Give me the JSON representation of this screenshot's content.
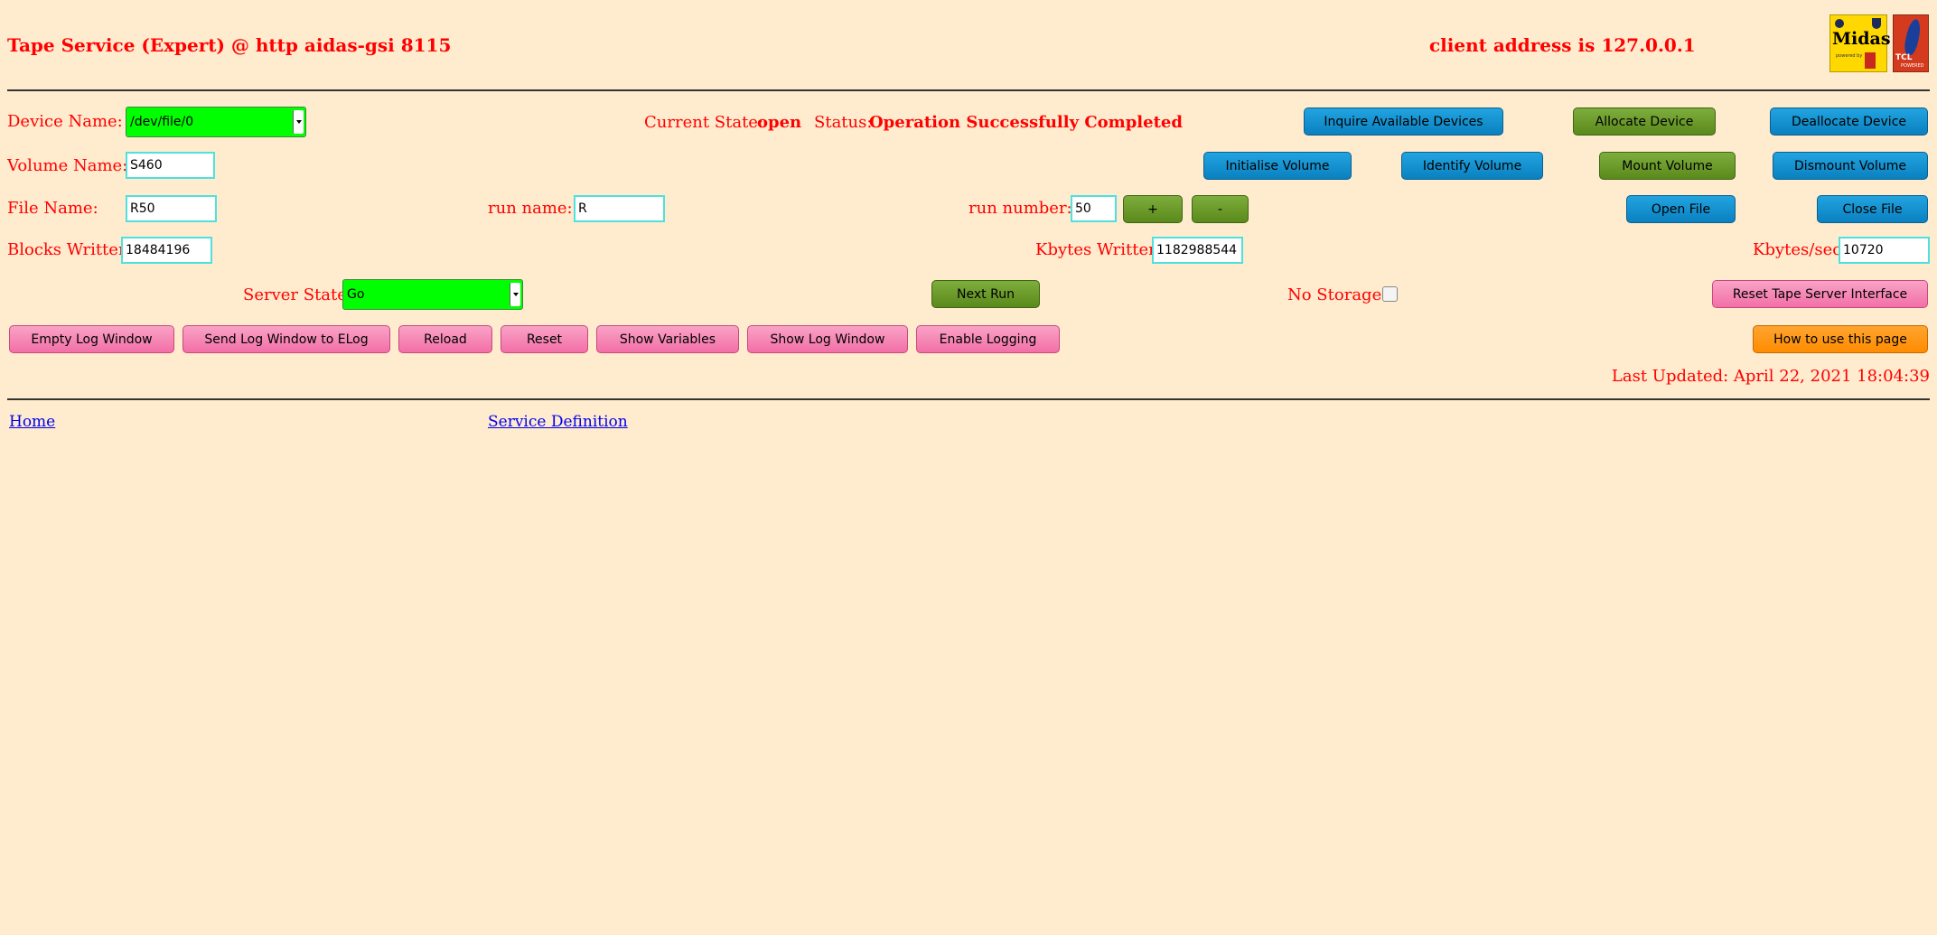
{
  "header": {
    "title": "Tape Service (Expert) @ http aidas-gsi 8115",
    "client_address": "client address is 127.0.0.1",
    "logos": {
      "midas_text": "Midas",
      "midas_small": "powered by",
      "tcl_text": "TCL",
      "tcl_small": "POWERED"
    }
  },
  "device": {
    "label": "Device Name:",
    "selected": "/dev/file/0",
    "current_state_label": "Current State:",
    "current_state": "open",
    "status_label": "Status:",
    "status": "Operation Successfully Completed",
    "inquire_button": "Inquire Available Devices",
    "allocate_button": "Allocate Device",
    "deallocate_button": "Deallocate Device"
  },
  "volume": {
    "label": "Volume Name:",
    "value": "S460",
    "initialise_button": "Initialise Volume",
    "identify_button": "Identify Volume",
    "mount_button": "Mount Volume",
    "dismount_button": "Dismount Volume"
  },
  "file": {
    "label": "File Name:",
    "value": "R50",
    "run_name_label": "run name:",
    "run_name": "R",
    "run_number_label": "run number:",
    "run_number": "50",
    "plus_button": "+",
    "minus_button": "-",
    "open_button": "Open File",
    "close_button": "Close File"
  },
  "stats": {
    "blocks_label": "Blocks Written:",
    "blocks": "18484196",
    "kbytes_label": "Kbytes Written:",
    "kbytes": "1182988544",
    "rate_label": "Kbytes/sec:",
    "rate": "10720"
  },
  "server": {
    "state_label": "Server State",
    "state": "Go",
    "next_run_button": "Next Run",
    "no_storage_label": "No Storage",
    "no_storage_checked": false,
    "reset_interface_button": "Reset Tape Server Interface"
  },
  "actions": {
    "empty_log": "Empty Log Window",
    "send_log": "Send Log Window to ELog",
    "reload": "Reload",
    "reset": "Reset",
    "show_variables": "Show Variables",
    "show_log": "Show Log Window",
    "enable_logging": "Enable Logging",
    "how_to": "How to use this page"
  },
  "last_updated": "Last Updated: April 22, 2021 18:04:39",
  "footer": {
    "home": "Home",
    "service_definition": "Service Definition"
  },
  "colors": {
    "background": "#ffebcd",
    "text": "#ff0000",
    "select_green": "#00ff00",
    "button_blue": "#0a80c0",
    "button_green": "#5b8a1c",
    "button_pink": "#f26fa7",
    "button_orange": "#ff8c00"
  }
}
